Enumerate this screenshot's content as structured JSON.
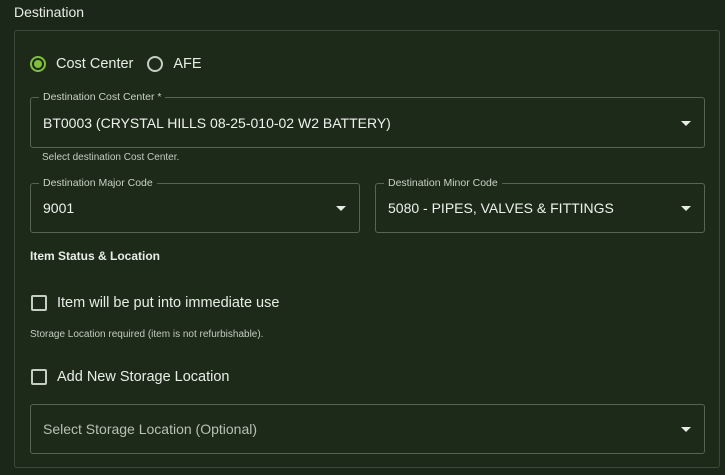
{
  "section": {
    "title": "Destination"
  },
  "destination_type": {
    "options": [
      {
        "label": "Cost Center",
        "selected": true
      },
      {
        "label": "AFE",
        "selected": false
      }
    ]
  },
  "cost_center": {
    "label": "Destination Cost Center *",
    "value": "BT0003 (CRYSTAL HILLS 08-25-010-02 W2 BATTERY)",
    "helper": "Select destination Cost Center."
  },
  "major_code": {
    "label": "Destination Major Code",
    "value": "9001"
  },
  "minor_code": {
    "label": "Destination Minor Code",
    "value": "5080 - PIPES, VALVES & FITTINGS"
  },
  "item_status": {
    "heading": "Item Status & Location",
    "immediate_use": {
      "label": "Item will be put into immediate use",
      "checked": false
    },
    "storage_helper": "Storage Location required (item is not refurbishable).",
    "add_storage": {
      "label": "Add New Storage Location",
      "checked": false
    },
    "storage_select": {
      "placeholder": "Select Storage Location (Optional)"
    }
  },
  "colors": {
    "background": "#1b2718",
    "accent": "#7fbf3f",
    "border": "#56654f"
  }
}
